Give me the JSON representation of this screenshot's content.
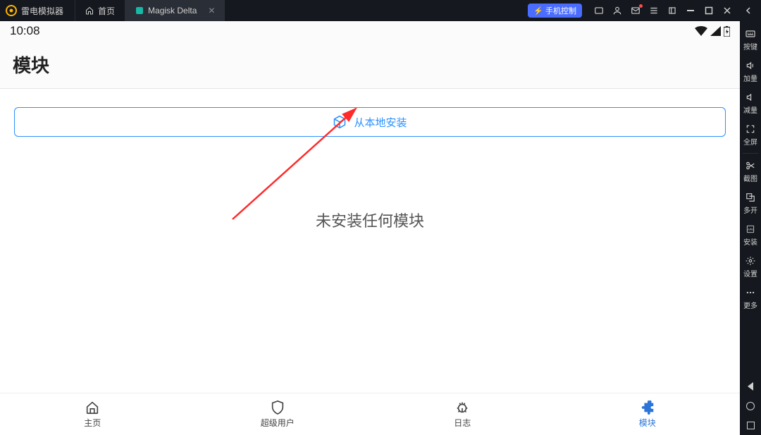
{
  "titlebar": {
    "app_name": "雷电模拟器",
    "tabs": [
      {
        "label": "首页"
      },
      {
        "label": "Magisk Delta"
      }
    ],
    "phone_control_label": "手机控制"
  },
  "right_sidebar": {
    "items": [
      {
        "label": "按键"
      },
      {
        "label": "加量"
      },
      {
        "label": "减量"
      },
      {
        "label": "全屏"
      },
      {
        "label": "截图"
      },
      {
        "label": "多开"
      },
      {
        "label": "安装"
      },
      {
        "label": "设置"
      },
      {
        "label": "更多"
      }
    ]
  },
  "statusbar": {
    "time": "10:08"
  },
  "appheader": {
    "title": "模块"
  },
  "content": {
    "install_label": "从本地安装",
    "empty_msg": "未安装任何模块"
  },
  "bottomnav": {
    "items": [
      {
        "label": "主页"
      },
      {
        "label": "超级用户"
      },
      {
        "label": "日志"
      },
      {
        "label": "模块"
      }
    ]
  },
  "colors": {
    "accent": "#2b90ff",
    "nav_active": "#2b74d8"
  }
}
